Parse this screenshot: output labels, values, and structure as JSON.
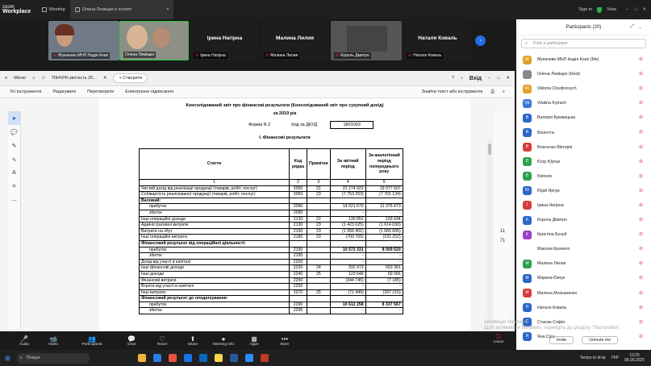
{
  "topbar": {
    "logo1": "zoom",
    "logo2": "Workplace",
    "meeting": "Meeting",
    "shared_screen": "Олена Леміщко's screen",
    "signin": "Sign in",
    "view": "View"
  },
  "videos": [
    {
      "name": "Мукачево МНЛ Надія Кнап"
    },
    {
      "name": "Олена Леміщко"
    },
    {
      "center": "Ірина Нагірна",
      "name": "Ірина Нагірна"
    },
    {
      "center": "Малина Лилия",
      "name": "Малина Лилия"
    },
    {
      "center": "",
      "name": "Король Дмитро"
    },
    {
      "center": "Наталя Коваль",
      "name": "Наталя Коваль"
    }
  ],
  "app": {
    "menu": "Меню",
    "doc_title": "ПІНЧУК-звітність 20...",
    "create": "Створити",
    "exit": "Вхід",
    "menus": [
      "Усі інструменти",
      "Редагувати",
      "Перетворити",
      "Електронне підписання"
    ],
    "find": "Знайти текст або інструменти"
  },
  "report": {
    "title": "Консолідований звіт про фінансові результати (Консолідований звіт про сукупний дохід)",
    "year": "за 2019 рік",
    "form": "Форма N 2",
    "code_label": "Код за ДКУД",
    "code": "1801003",
    "section": "I. Фінансові результати",
    "headers": [
      "Стаття",
      "Код рядка",
      "Примітки",
      "За звітний період",
      "За аналогічний період попереднього року"
    ],
    "numrow": [
      "1",
      "2",
      "3",
      "4",
      "5"
    ],
    "rows": [
      [
        "Чистий дохід від реалізації продукції (товарів, робіт, послуг)",
        "2000",
        "21",
        "22 274 923",
        "19 077 607"
      ],
      [
        "Собівартість реалізованої продукції (товарів, робіт, послуг)",
        "2050",
        "23",
        "(7 753 253)",
        "(7 701 134)"
      ],
      [
        "Валовий:",
        "",
        "",
        "",
        ""
      ],
      [
        "прибуток",
        "2090",
        "",
        "14 521 670",
        "11 376 473"
      ],
      [
        "збиток",
        "2095",
        "",
        "-",
        "-"
      ],
      [
        "Інші операційні доходи",
        "2120",
        "22",
        "130 852",
        "103 934"
      ],
      [
        "Адміністративні витрати",
        "2130",
        "23",
        "(1 423 025)",
        "(1 614 030)"
      ],
      [
        "Витрати на збут",
        "2150",
        "23",
        "(1 956 401)",
        "(1 665 605)"
      ],
      [
        "Інші операційні витрати",
        "2180",
        "23",
        "(700 765)",
        "(191 252)"
      ],
      [
        "Фінансовий результат від операційної діяльності:",
        "",
        "",
        "",
        ""
      ],
      [
        "прибуток",
        "2190",
        "",
        "10 572 331",
        "8 009 520"
      ],
      [
        "збиток",
        "2195",
        "",
        "-",
        "-"
      ],
      [
        "Дохід від участі в капіталі",
        "2200",
        "",
        "-",
        "-"
      ],
      [
        "Інші фінансові доходи",
        "2220",
        "24",
        "332 973",
        "563 391"
      ],
      [
        "Інші доходи",
        "2240",
        "25",
        "123 648",
        "69 056"
      ],
      [
        "Фінансові витрати",
        "2250",
        "",
        "(344 745)",
        "(7 185)"
      ],
      [
        "Втрати від участі в капіталі",
        "2255",
        "",
        "-",
        "-"
      ],
      [
        "Інші витрати",
        "2270",
        "25",
        "(71 949)",
        "(297 215)"
      ],
      [
        "Фінансовий результат до оподаткування:",
        "",
        "",
        "",
        ""
      ],
      [
        "прибуток",
        "2290",
        "",
        "10 612 258",
        "8 337 567"
      ],
      [
        "збиток",
        "2295",
        "",
        "-",
        "-"
      ]
    ]
  },
  "rightbar": {
    "page": "11",
    "total": "71"
  },
  "participants": {
    "title": "Participants (20)",
    "search_placeholder": "Find a participant",
    "list": [
      {
        "i": "М",
        "c": "#e3a02b",
        "n": "Мукачево МНЛ Надія Кнап (Me)"
      },
      {
        "i": "",
        "c": "#888",
        "n": "Олена Леміщко (Host)"
      },
      {
        "i": "VC",
        "c": "#e3a02b",
        "n": "Viktoria Chudinovych"
      },
      {
        "i": "VK",
        "c": "#3a74d8",
        "n": "Vitalina Kytrach"
      },
      {
        "i": "В",
        "c": "#2c66c7",
        "n": "Валерія Брежицька"
      },
      {
        "i": "В",
        "c": "#2c66c7",
        "n": "Віолетта"
      },
      {
        "i": "В",
        "c": "#d93a3a",
        "n": "Власенко Вікторія"
      },
      {
        "i": "Є",
        "c": "#2ea04f",
        "n": "Єгор Юрчук"
      },
      {
        "i": "Є",
        "c": "#2ea04f",
        "n": "Євгенія"
      },
      {
        "i": "Ю",
        "c": "#2c66c7",
        "n": "Юрій Ярчук"
      },
      {
        "i": "І",
        "c": "#d93a3a",
        "n": "Ірина Нагірна"
      },
      {
        "i": "К",
        "c": "#2c66c7",
        "n": "Король Дмитро"
      },
      {
        "i": "К",
        "c": "#9a3fc7",
        "n": "Кристіна Булуй"
      },
      {
        "i": "",
        "c": "#fff",
        "n": "Максим Крачило"
      },
      {
        "i": "М",
        "c": "#2ea04f",
        "n": "Малина Лилия"
      },
      {
        "i": "М",
        "c": "#2c66c7",
        "n": "Марина Євчук"
      },
      {
        "i": "М",
        "c": "#d93a3a",
        "n": "Милена Москаненко"
      },
      {
        "i": "Н",
        "c": "#2c66c7",
        "n": "Наталя Коваль"
      },
      {
        "i": "С",
        "c": "#2c66c7",
        "n": "Стасюк Софія"
      },
      {
        "i": "Я",
        "c": "#2c66c7",
        "n": "Яна Сіра"
      }
    ],
    "invite": "Invite",
    "unmute": "Unmute me"
  },
  "watermark": [
    "Активація Windows",
    "Щоб активувати Windows, перейдіть до розділу \"Настройки\"."
  ],
  "toolbar": [
    {
      "g": "🎤",
      "l": "Audio"
    },
    {
      "g": "📹",
      "l": "Video"
    },
    {
      "g": "👥",
      "l": "Participants"
    },
    {
      "g": "💬",
      "l": "Chat"
    },
    {
      "g": "♡",
      "l": "React"
    },
    {
      "g": "⬆",
      "l": "Share"
    },
    {
      "g": "●",
      "l": "Meeting info"
    },
    {
      "g": "▦",
      "l": "Apps"
    },
    {
      "g": "•••",
      "l": "More"
    }
  ],
  "participant_count": "20",
  "leave": "Leave",
  "taskbar": {
    "search": "Пошук",
    "drop": "Temps to drop",
    "lang": "УКР",
    "time": "10:25",
    "date": "08.09.2025"
  }
}
